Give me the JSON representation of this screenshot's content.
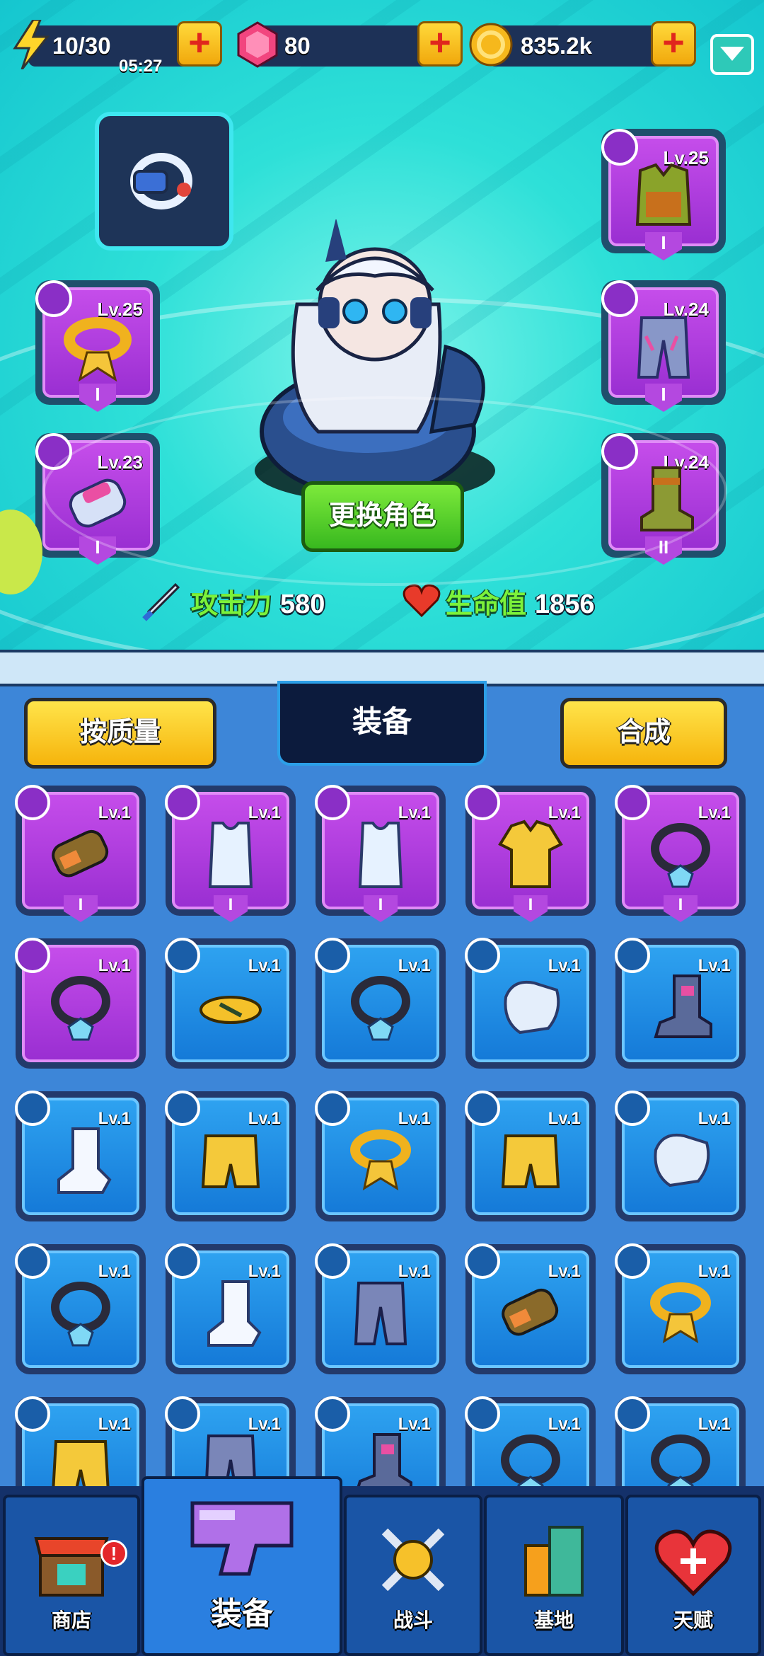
{
  "resources": {
    "energy": {
      "value": "10/30",
      "timer": "05:27",
      "icon": "lightning-icon"
    },
    "gems": {
      "value": "80",
      "icon": "gem-icon"
    },
    "coins": {
      "value": "835.2k",
      "icon": "coin-icon"
    },
    "plus": "+"
  },
  "hero": {
    "change_button": "更换角色",
    "attack_label": "攻击力",
    "attack_value": "580",
    "hp_label": "生命值",
    "hp_value": "1856"
  },
  "equipped": {
    "necklace": {
      "level": "Lv.25",
      "tag": "I"
    },
    "gloves": {
      "level": "Lv.23",
      "tag": "I"
    },
    "armor": {
      "level": "Lv.25",
      "tag": "I"
    },
    "pants": {
      "level": "Lv.24",
      "tag": "I"
    },
    "boots": {
      "level": "Lv.24",
      "tag": "II"
    }
  },
  "panel": {
    "sort_button": "按质量",
    "title": "装备",
    "merge_button": "合成"
  },
  "inventory": [
    {
      "level": "Lv.1",
      "rarity": "purple",
      "item": "gauntlet",
      "tag": "I"
    },
    {
      "level": "Lv.1",
      "rarity": "purple",
      "item": "tank-top",
      "tag": "I"
    },
    {
      "level": "Lv.1",
      "rarity": "purple",
      "item": "tank-top",
      "tag": "I"
    },
    {
      "level": "Lv.1",
      "rarity": "purple",
      "item": "shirt",
      "tag": "I"
    },
    {
      "level": "Lv.1",
      "rarity": "purple",
      "item": "necklace",
      "tag": "I"
    },
    {
      "level": "Lv.1",
      "rarity": "purple",
      "item": "necklace",
      "tag": ""
    },
    {
      "level": "Lv.1",
      "rarity": "blue",
      "item": "sandals",
      "tag": ""
    },
    {
      "level": "Lv.1",
      "rarity": "blue",
      "item": "necklace",
      "tag": ""
    },
    {
      "level": "Lv.1",
      "rarity": "blue",
      "item": "glove",
      "tag": ""
    },
    {
      "level": "Lv.1",
      "rarity": "blue",
      "item": "boots",
      "tag": ""
    },
    {
      "level": "Lv.1",
      "rarity": "blue",
      "item": "sock",
      "tag": ""
    },
    {
      "level": "Lv.1",
      "rarity": "blue",
      "item": "shorts",
      "tag": ""
    },
    {
      "level": "Lv.1",
      "rarity": "blue",
      "item": "scarf",
      "tag": ""
    },
    {
      "level": "Lv.1",
      "rarity": "blue",
      "item": "shorts",
      "tag": ""
    },
    {
      "level": "Lv.1",
      "rarity": "blue",
      "item": "glove",
      "tag": ""
    },
    {
      "level": "Lv.1",
      "rarity": "blue",
      "item": "necklace",
      "tag": ""
    },
    {
      "level": "Lv.1",
      "rarity": "blue",
      "item": "sock",
      "tag": ""
    },
    {
      "level": "Lv.1",
      "rarity": "blue",
      "item": "pants",
      "tag": ""
    },
    {
      "level": "Lv.1",
      "rarity": "blue",
      "item": "gauntlet",
      "tag": ""
    },
    {
      "level": "Lv.1",
      "rarity": "blue",
      "item": "scarf",
      "tag": ""
    },
    {
      "level": "Lv.1",
      "rarity": "blue",
      "item": "shorts",
      "tag": ""
    },
    {
      "level": "Lv.1",
      "rarity": "blue",
      "item": "pants",
      "tag": ""
    },
    {
      "level": "Lv.1",
      "rarity": "blue",
      "item": "boots",
      "tag": ""
    },
    {
      "level": "Lv.1",
      "rarity": "blue",
      "item": "necklace",
      "tag": ""
    },
    {
      "level": "Lv.1",
      "rarity": "blue",
      "item": "necklace",
      "tag": ""
    }
  ],
  "nav": {
    "shop": "商店",
    "shop_badge": "!",
    "equipment": "装备",
    "battle": "战斗",
    "base": "基地",
    "talent": "天赋"
  },
  "colors": {
    "stage_bg": "#2ee0d8",
    "purple_rarity": "#b040e0",
    "blue_rarity": "#1e8ce6",
    "button_yellow": "#f9c51b",
    "button_green": "#4fcf2a",
    "label_green": "#7cf23a"
  }
}
